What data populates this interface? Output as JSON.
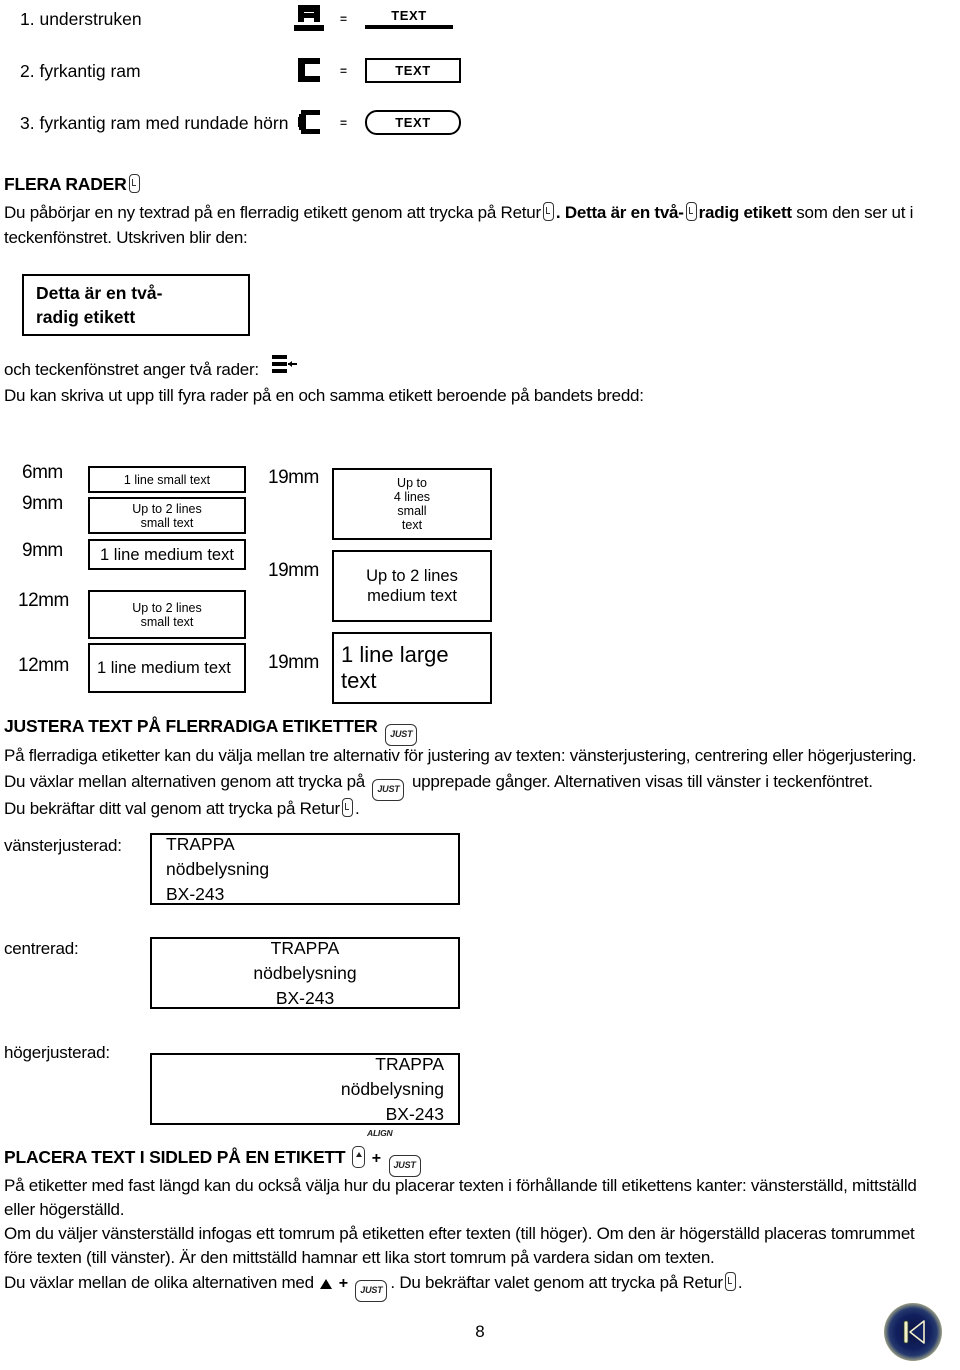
{
  "frame_options": [
    {
      "label": "1. understruken",
      "icon": "underline-frame-icon",
      "sample": "TEXT",
      "style": "underline"
    },
    {
      "label": "2. fyrkantig ram",
      "icon": "square-frame-icon",
      "sample": "TEXT",
      "style": "box"
    },
    {
      "label": "3. fyrkantig ram med rundade hörn",
      "icon": "rounded-frame-icon",
      "sample": "TEXT",
      "style": "rounded"
    }
  ],
  "equals_sign": "=",
  "multi_line": {
    "heading": "FLERA RADER",
    "heading_key": "return-key",
    "para_1a": "Du påbörjar en ny textrad på en flerradig etikett genom att trycka på Retur",
    "para_1b": ". ",
    "para_1c": "Detta är en två-",
    "para_1d": "radig etikett",
    "para_1e": " som den ser ut i",
    "para_2": "teckenfönstret. Utskriven blir den:",
    "printed_label_line1": "Detta är en två-",
    "printed_label_line2": "radig etikett",
    "para_3": "och teckenfönstret anger två rader:",
    "para_4": "Du kan skriva ut upp till fyra rader på en och samma etikett beroende på bandets bredd:"
  },
  "tape_sizes": {
    "left_column": [
      {
        "size": "6mm",
        "text": "1 line small text",
        "text_size": "small",
        "align": "center"
      },
      {
        "size": "9mm",
        "text": "Up to 2 lines\nsmall text",
        "text_size": "small",
        "align": "center"
      },
      {
        "size": "9mm",
        "text": "1 line medium text",
        "text_size": "medium",
        "align": "center"
      },
      {
        "size": "12mm",
        "text": "Up to 2 lines\nsmall text",
        "text_size": "small",
        "align": "center"
      },
      {
        "size": "12mm",
        "text": "1 line medium text",
        "text_size": "medium",
        "align": "left"
      }
    ],
    "right_column": [
      {
        "size": "19mm",
        "text": "Up to\n4 lines\nsmall\ntext",
        "text_size": "small",
        "align": "center"
      },
      {
        "size": "19mm",
        "text": "Up to 2 lines\nmedium text",
        "text_size": "medium",
        "align": "center"
      },
      {
        "size": "19mm",
        "text": "1 line large text",
        "text_size": "large",
        "align": "left"
      }
    ]
  },
  "justify": {
    "heading": "JUSTERA TEXT PÅ FLERRADIGA ETIKETTER",
    "heading_key": "JUST",
    "para_1": "På flerradiga etiketter kan du välja mellan tre alternativ för justering av texten: vänsterjustering, centrering eller högerjustering.",
    "para_2a": "Du växlar mellan alternativen genom att trycka på",
    "para_2_key": "JUST",
    "para_2b": "upprepade gånger. Alternativen visas till vänster i teckenföntret.",
    "para_3": "Du bekräftar ditt val genom att trycka på Retur",
    "examples": [
      {
        "caption": "vänsterjusterad:",
        "lines": [
          "TRAPPA",
          "nödbelysning",
          "BX-243"
        ],
        "align": "left"
      },
      {
        "caption": "centrerad:",
        "lines": [
          "TRAPPA",
          "nödbelysning",
          "BX-243"
        ],
        "align": "center"
      },
      {
        "caption": "högerjusterad:",
        "lines": [
          "TRAPPA",
          "nödbelysning",
          "BX-243"
        ],
        "align": "right"
      }
    ]
  },
  "align_section": {
    "heading": "PLACERA TEXT I SIDLED PÅ EN ETIKETT",
    "key_up": "up-arrow-key",
    "key_plus": "+",
    "key_align_caption": "ALIGN",
    "key_just": "JUST",
    "para_1": "På etiketter med fast längd kan du också välja hur du placerar texten i förhållande till etikettens kanter: vänsterställd, mittställd",
    "para_2": "eller högerställd.",
    "para_3": "Om du väljer vänsterställd infogas ett tomrum på etiketten efter texten (till höger). Om den är högerställd placeras tomrummet",
    "para_4": "före texten (till vänster). Är den mittställd hamnar ett lika stort tomrum på vardera sidan om texten.",
    "para_5a": "Du växlar mellan de olika alternativen med",
    "para_5_key": "JUST",
    "para_5b": ". Du bekräftar valet genom att trycka på Retur",
    "para_5c": "."
  },
  "footer": {
    "page_number": "8",
    "back_button": "skip-to-start-icon"
  }
}
